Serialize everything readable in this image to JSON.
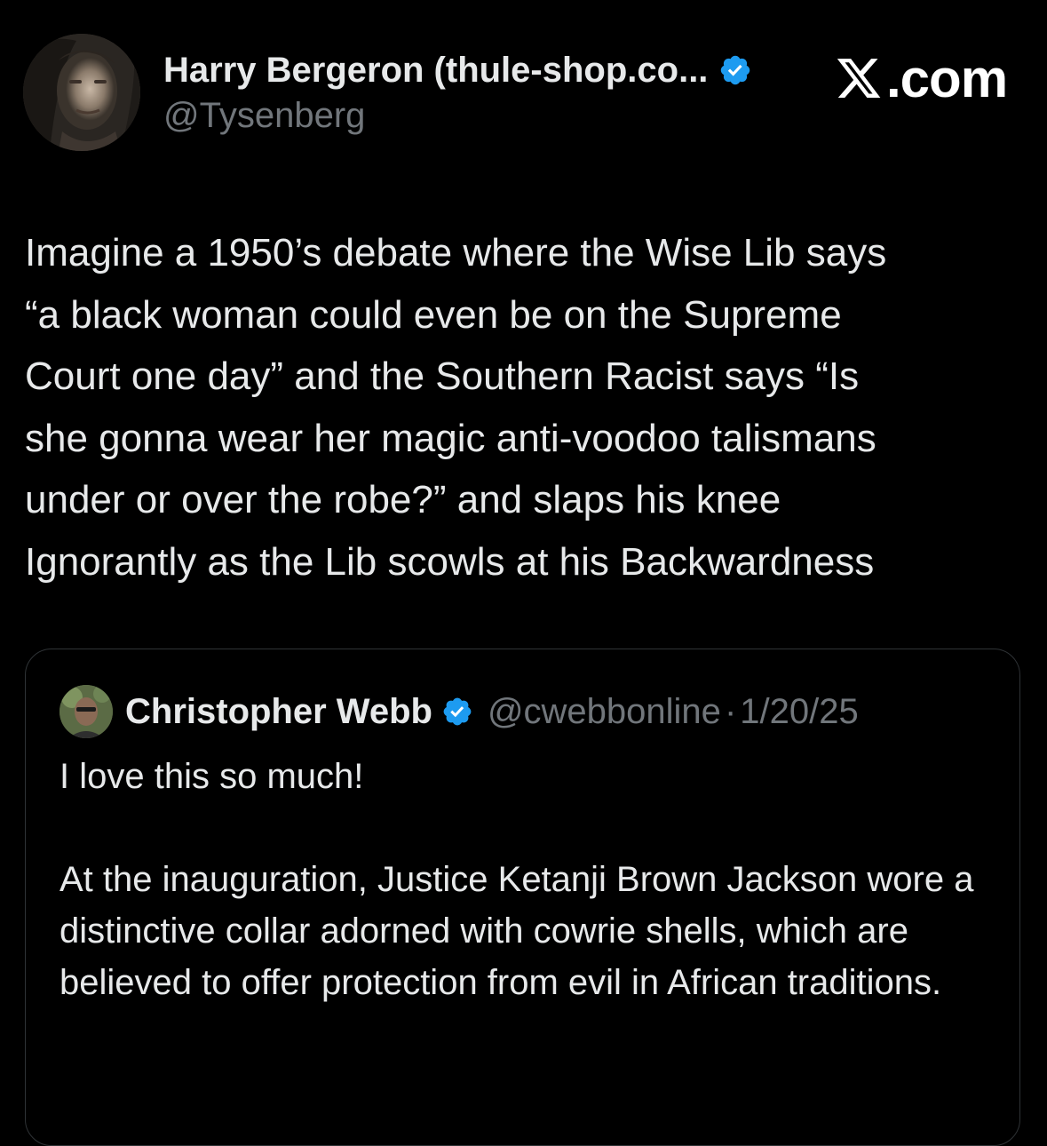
{
  "author": {
    "display_name": "Harry Bergeron (thule-shop.co...",
    "handle": "@Tysenberg",
    "verified": true
  },
  "brand": {
    "logo_text": ".com",
    "logo_icon": "x-logo-icon"
  },
  "tweet": {
    "text": "Imagine a 1950’s debate where the Wise Lib says\n“a black woman could even be on the Supreme\nCourt one day” and the Southern Racist says “Is\nshe gonna wear her magic anti-voodoo talismans\nunder or over the robe?” and slaps his knee\nIgnorantly as the Lib scowls at his Backwardness"
  },
  "quoted_tweet": {
    "display_name": "Christopher Webb",
    "handle": "@cwebbonline",
    "separator": "·",
    "date": "1/20/25",
    "verified": true,
    "paragraphs": [
      "I love this so much!",
      "At the inauguration, Justice Ketanji Brown Jackson wore a distinctive collar adorned with cowrie shells, which are believed to offer protection from evil in African traditions."
    ]
  },
  "colors": {
    "background": "#000000",
    "primary_text": "#e7e9ea",
    "secondary_text": "#71767b",
    "verified_blue": "#1d9bf0",
    "border": "#2f3336"
  }
}
